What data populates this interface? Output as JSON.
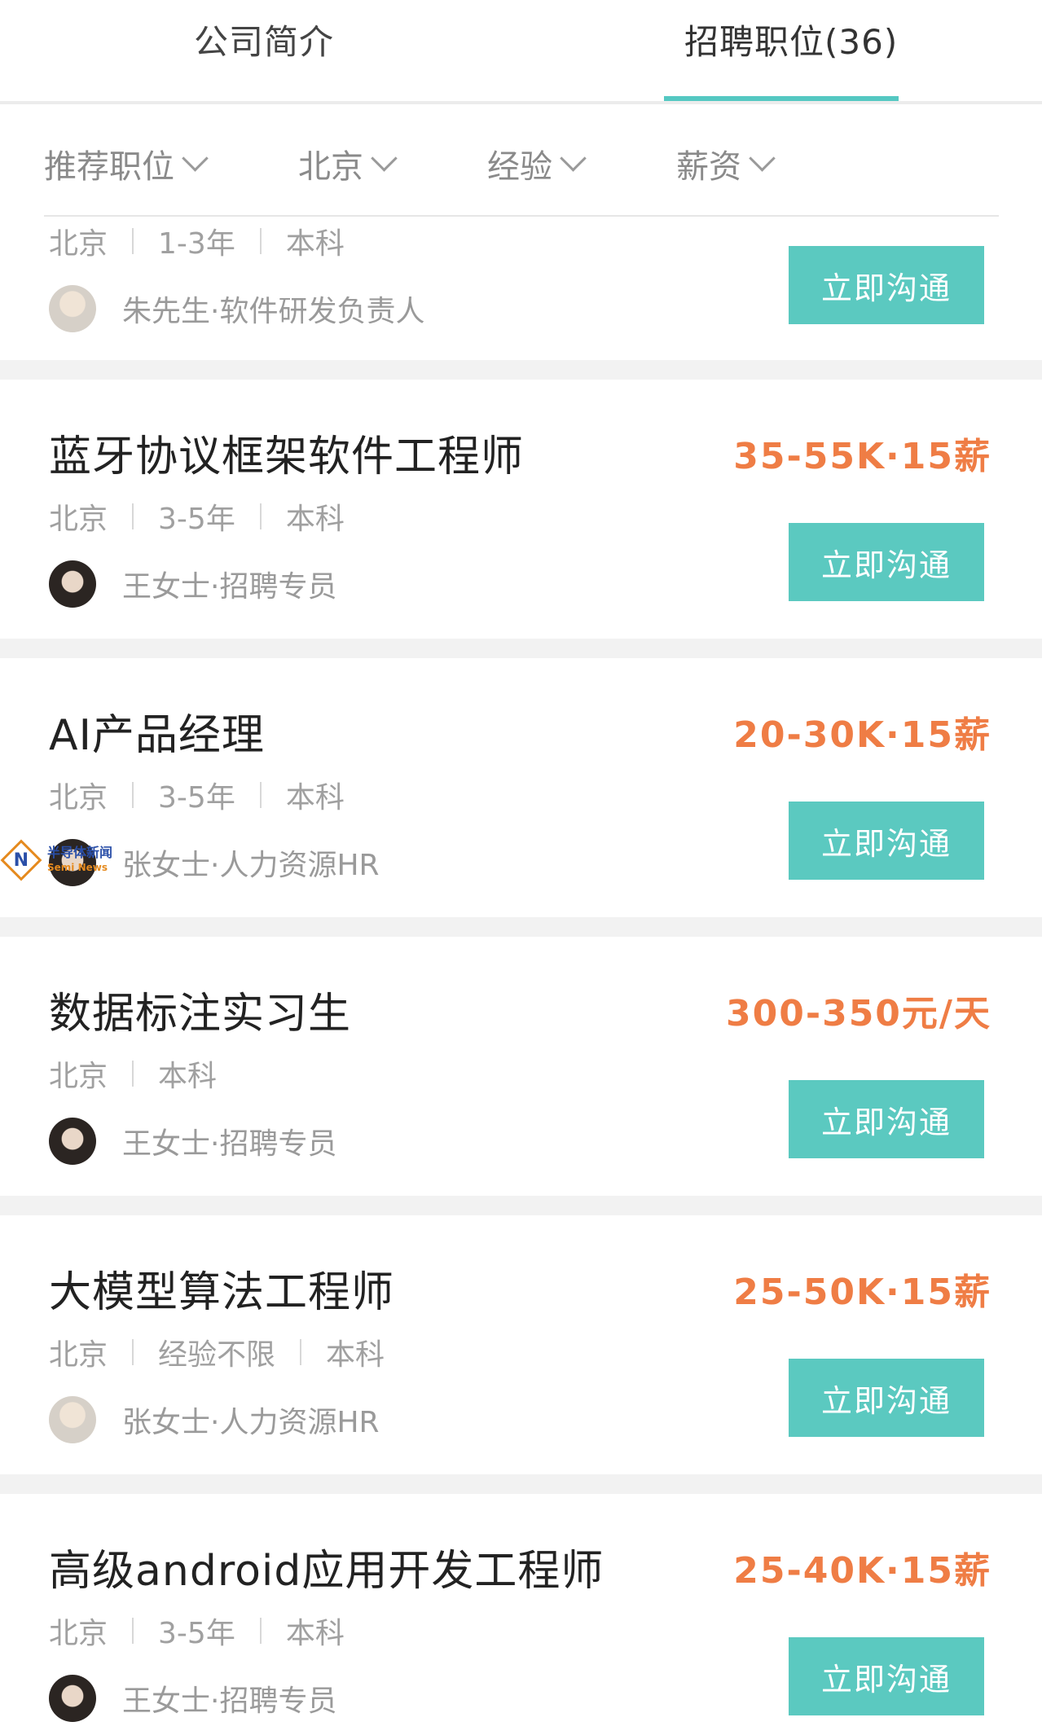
{
  "tabs": [
    {
      "label": "公司简介"
    },
    {
      "label": "招聘职位(36)"
    }
  ],
  "filters": [
    {
      "label": "推荐职位"
    },
    {
      "label": "北京"
    },
    {
      "label": "经验"
    },
    {
      "label": "薪资"
    }
  ],
  "partial_job": {
    "meta": [
      "北京",
      "1-3年",
      "本科"
    ],
    "person": "朱先生·软件研发负责人",
    "button": "立即沟通"
  },
  "jobs": [
    {
      "title": "蓝牙协议框架软件工程师",
      "salary": "35-55K·15薪",
      "meta": [
        "北京",
        "3-5年",
        "本科"
      ],
      "person": "王女士·招聘专员",
      "button": "立即沟通"
    },
    {
      "title": "AI产品经理",
      "salary": "20-30K·15薪",
      "meta": [
        "北京",
        "3-5年",
        "本科"
      ],
      "person": "张女士·人力资源HR",
      "button": "立即沟通"
    },
    {
      "title": "数据标注实习生",
      "salary": "300-350元/天",
      "meta": [
        "北京",
        "本科"
      ],
      "person": "王女士·招聘专员",
      "button": "立即沟通"
    },
    {
      "title": "大模型算法工程师",
      "salary": "25-50K·15薪",
      "meta": [
        "北京",
        "经验不限",
        "本科"
      ],
      "person": "张女士·人力资源HR",
      "button": "立即沟通"
    },
    {
      "title": "高级android应用开发工程师",
      "salary": "25-40K·15薪",
      "meta": [
        "北京",
        "3-5年",
        "本科"
      ],
      "person": "王女士·招聘专员",
      "button": "立即沟通"
    }
  ],
  "watermark": {
    "icon_letter": "N",
    "name": "半导体新闻",
    "sub": "Semi News"
  },
  "colors": {
    "accent": "#5bc9c0",
    "salary": "#ef7d45"
  }
}
